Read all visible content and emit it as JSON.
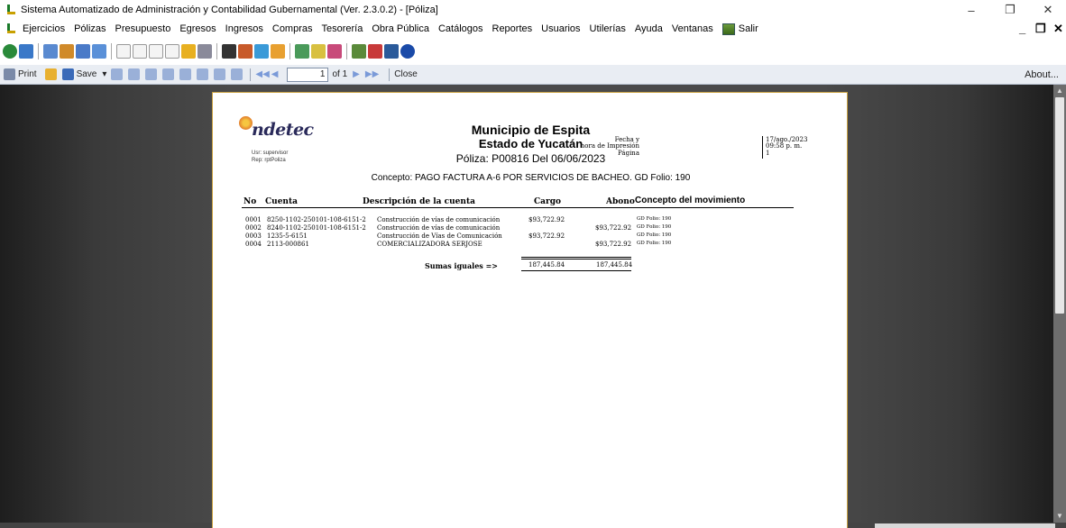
{
  "window": {
    "title": "Sistema Automatizado de Administración y Contabilidad Gubernamental  (Ver. 2.3.0.2) - [Póliza]"
  },
  "menu": {
    "items": [
      "Ejercicios",
      "Pólizas",
      "Presupuesto",
      "Egresos",
      "Ingresos",
      "Compras",
      "Tesorería",
      "Obra Pública",
      "Catálogos",
      "Reportes",
      "Usuarios",
      "Utilerías",
      "Ayuda",
      "Ventanas"
    ],
    "salir": "Salir"
  },
  "viewer": {
    "print": "Print",
    "save": "Save",
    "page_value": "1",
    "page_of": "of 1",
    "close": "Close",
    "about": "About..."
  },
  "report": {
    "logo": "ndetec",
    "user_line": "Usr: supervisor",
    "rep_line": "Rep: rptPoliza",
    "municipio": "Municipio de Espita",
    "estado": "Estado de Yucatán",
    "poliza_line": "Póliza:  P00816  Del 06/06/2023",
    "meta_label_1": "Fecha y",
    "meta_label_2": "hora de Impresión",
    "meta_label_3": "Página",
    "meta_fecha": "17/ago./2023",
    "meta_hora": "09:58 p. m.",
    "meta_pagina": "1",
    "concepto": "Concepto: PAGO FACTURA A-6 POR SERVICIOS DE BACHEO. GD Folio: 190",
    "headers": {
      "no": "No",
      "cuenta": "Cuenta",
      "descripcion": "Descripción de la cuenta",
      "cargo": "Cargo",
      "abono": "Abono",
      "concepto": "Concepto del movimiento"
    },
    "rows": [
      {
        "no": "0001",
        "cuenta": "8250-1102-250101-108-6151-2",
        "descripcion": "Construcción de vías de comunicación",
        "cargo": "$93,722.92",
        "abono": "",
        "concepto": "GD Folio: 190"
      },
      {
        "no": "0002",
        "cuenta": "8240-1102-250101-108-6151-2",
        "descripcion": "Construcción de vías de comunicación",
        "cargo": "",
        "abono": "$93,722.92",
        "concepto": "GD Folio: 190"
      },
      {
        "no": "0003",
        "cuenta": "1235-5-6151",
        "descripcion": "Construcción de Vías de Comunicación",
        "cargo": "$93,722.92",
        "abono": "",
        "concepto": "GD Folio: 190"
      },
      {
        "no": "0004",
        "cuenta": "2113-000861",
        "descripcion": "COMERCIALIZADORA SERJOSE",
        "cargo": "",
        "abono": "$93,722.92",
        "concepto": "GD Folio: 190"
      }
    ],
    "sumas_label": "Sumas iguales =>",
    "sumas_cargo": "187,445.84",
    "sumas_abono": "187,445.84"
  }
}
